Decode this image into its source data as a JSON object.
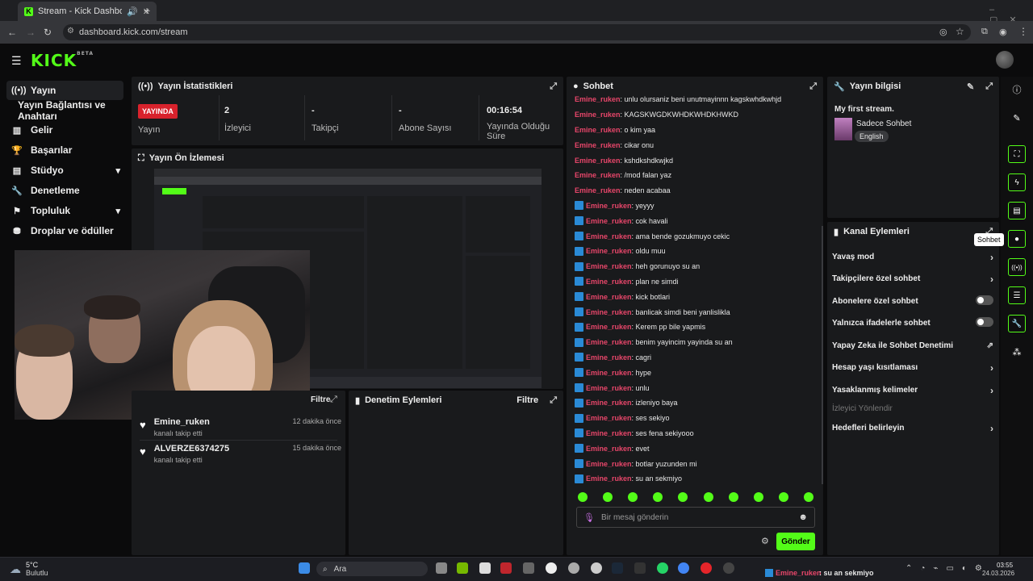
{
  "browser": {
    "tab_title": "Stream - Kick Dashboard",
    "url": "dashboard.kick.com/stream",
    "new_tab": "+"
  },
  "brand": {
    "logo": "KICK",
    "beta": "BETA",
    "accent": "#53fc18"
  },
  "sidebar": {
    "items": [
      {
        "label": "Yayın",
        "icon": "broadcast-icon"
      },
      {
        "label": "Yayın Bağlantısı ve Anahtarı",
        "icon": ""
      },
      {
        "label": "Gelir",
        "icon": "chart-icon"
      },
      {
        "label": "Başarılar",
        "icon": "trophy-icon"
      },
      {
        "label": "Stüdyo",
        "icon": "studio-icon"
      },
      {
        "label": "Denetleme",
        "icon": "wrench-icon"
      },
      {
        "label": "Topluluk",
        "icon": "community-icon"
      },
      {
        "label": "Droplar ve ödüller",
        "icon": "gift-icon"
      }
    ]
  },
  "stats": {
    "title": "Yayın İstatistikleri",
    "live_badge": "YAYINDA",
    "live_label": "Yayın",
    "viewers_value": "2",
    "viewers_label": "İzleyici",
    "followers_value": "-",
    "followers_label": "Takipçi",
    "subs_value": "-",
    "subs_label": "Abone Sayısı",
    "uptime_value": "00:16:54",
    "uptime_label": "Yayında Olduğu Süre"
  },
  "preview": {
    "title": "Yayın Ön İzlemesi"
  },
  "activity": {
    "filter": "Filtre",
    "items": [
      {
        "name": "Emine_ruken",
        "action": "kanalı takip etti",
        "time": "12 dakika önce"
      },
      {
        "name": "ALVERZE6374275",
        "action": "kanalı takip etti",
        "time": "15 dakika önce"
      }
    ]
  },
  "moderation": {
    "title": "Denetim Eylemleri",
    "filter": "Filtre"
  },
  "chat": {
    "title": "Sohbet",
    "messages": [
      {
        "user": "Emine_ruken",
        "text": ": unlu olursaniz beni unutmayinnn kagskwhdkwhjd",
        "badge": false
      },
      {
        "user": "Emine_ruken",
        "text": ": KAGSKWGDKWHDKWHDKHWKD",
        "badge": false
      },
      {
        "user": "Emine_ruken",
        "text": ": o kim yaa",
        "badge": false
      },
      {
        "user": "Emine_ruken",
        "text": ": cikar onu",
        "badge": false
      },
      {
        "user": "Emine_ruken",
        "text": ": kshdkshdkwjkd",
        "badge": false
      },
      {
        "user": "Emine_ruken",
        "text": ": /mod falan yaz",
        "badge": false
      },
      {
        "user": "Emine_ruken",
        "text": ": neden acabaa",
        "badge": false
      },
      {
        "user": "Emine_ruken",
        "text": ": yeyyy",
        "badge": true
      },
      {
        "user": "Emine_ruken",
        "text": ": cok havali",
        "badge": true
      },
      {
        "user": "Emine_ruken",
        "text": ": ama bende gozukmuyo cekic",
        "badge": true
      },
      {
        "user": "Emine_ruken",
        "text": ": oldu muu",
        "badge": true
      },
      {
        "user": "Emine_ruken",
        "text": ": heh gorunuyo su an",
        "badge": true
      },
      {
        "user": "Emine_ruken",
        "text": ": plan ne simdi",
        "badge": true
      },
      {
        "user": "Emine_ruken",
        "text": ": kick botlari",
        "badge": true
      },
      {
        "user": "Emine_ruken",
        "text": ": banlicak simdi beni yanlislikla",
        "badge": true
      },
      {
        "user": "Emine_ruken",
        "text": ": Kerem pp bile yapmis",
        "badge": true
      },
      {
        "user": "Emine_ruken",
        "text": ": benim yayincim yayinda su an",
        "badge": true
      },
      {
        "user": "Emine_ruken",
        "text": ": cagri",
        "badge": true
      },
      {
        "user": "Emine_ruken",
        "text": ": hype",
        "badge": true
      },
      {
        "user": "Emine_ruken",
        "text": ": unlu",
        "badge": true
      },
      {
        "user": "Emine_ruken",
        "text": ": izleniyo baya",
        "badge": true
      },
      {
        "user": "Emine_ruken",
        "text": ": ses sekiyo",
        "badge": true
      },
      {
        "user": "Emine_ruken",
        "text": ": ses fena sekiyooo",
        "badge": true
      },
      {
        "user": "Emine_ruken",
        "text": ": evet",
        "badge": true
      },
      {
        "user": "Emine_ruken",
        "text": ": botlar yuzunden mi",
        "badge": true
      },
      {
        "user": "Emine_ruken",
        "text": ": su an sekmiyo",
        "badge": true
      }
    ],
    "input_placeholder": "Bir mesaj gönderin",
    "send_label": "Gönder"
  },
  "stream_info": {
    "title": "Yayın bilgisi",
    "stream_title": "My first stream.",
    "category": "Sadece Sohbet",
    "language": "English"
  },
  "channel_actions": {
    "title": "Kanal Eylemleri",
    "rows": [
      {
        "label": "Yavaş mod",
        "control": "chevron"
      },
      {
        "label": "Takipçilere özel sohbet",
        "control": "chevron"
      },
      {
        "label": "Abonelere özel sohbet",
        "control": "toggle"
      },
      {
        "label": "Yalnızca ifadelerle sohbet",
        "control": "toggle"
      },
      {
        "label": "Yapay Zeka ile Sohbet Denetimi",
        "control": "external"
      },
      {
        "label": "Hesap yaşı kısıtlaması",
        "control": "chevron"
      },
      {
        "label": "Yasaklanmış kelimeler",
        "control": "chevron"
      },
      {
        "label": "İzleyici Yönlendir",
        "control": "disabled"
      },
      {
        "label": "Hedefleri belirleyin",
        "control": "chevron"
      }
    ]
  },
  "rail": {
    "tooltip": "Sohbet"
  },
  "taskbar": {
    "weather_temp": "5°C",
    "weather_desc": "Bulutlu",
    "search": "Ara",
    "notification_user": "Emine_ruken",
    "notification_text": ": su an sekmiyo",
    "time": "03:55",
    "date": "24.03.2026"
  }
}
